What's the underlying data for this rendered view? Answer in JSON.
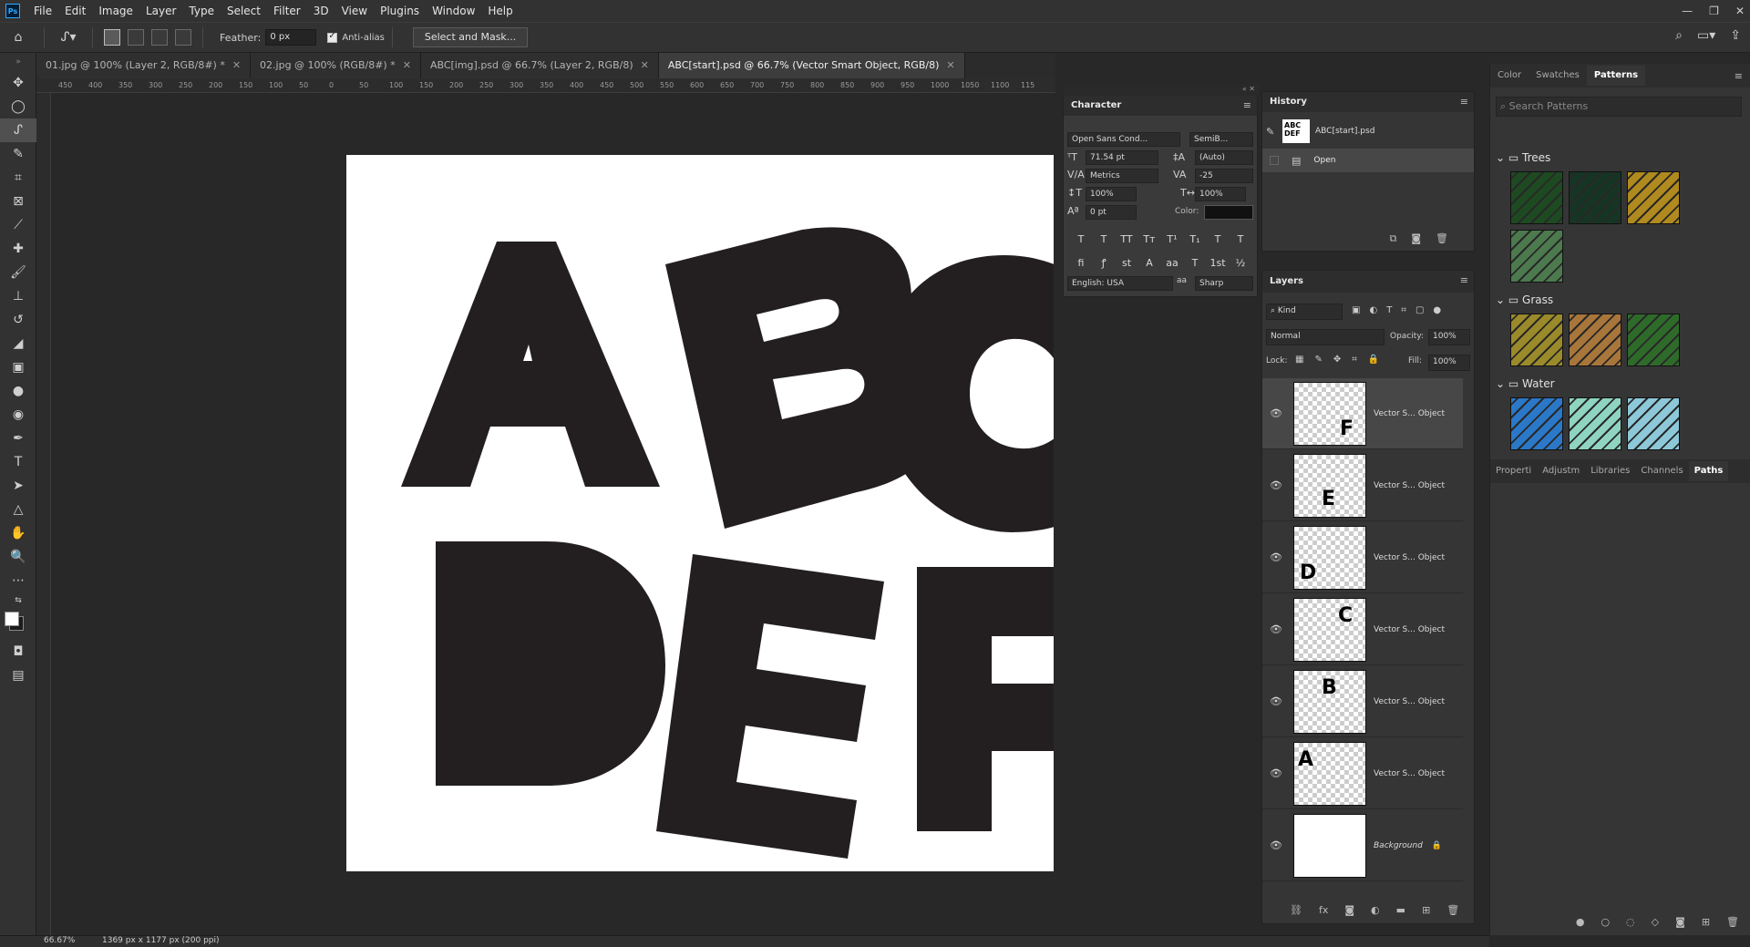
{
  "app": {
    "logo": "Ps"
  },
  "menu": [
    "File",
    "Edit",
    "Image",
    "Layer",
    "Type",
    "Select",
    "Filter",
    "3D",
    "View",
    "Plugins",
    "Window",
    "Help"
  ],
  "window_controls": [
    "—",
    "❐",
    "✕"
  ],
  "options": {
    "feather_label": "Feather:",
    "feather_value": "0 px",
    "antialias_label": "Anti-alias",
    "select_mask_label": "Select and Mask..."
  },
  "tabs": [
    {
      "label": "01.jpg @ 100% (Layer 2, RGB/8#) *",
      "active": false
    },
    {
      "label": "02.jpg @ 100% (RGB/8#) *",
      "active": false
    },
    {
      "label": "ABC[img].psd @ 66.7% (Layer 2, RGB/8)",
      "active": false
    },
    {
      "label": "ABC[start].psd @ 66.7% (Vector Smart Object, RGB/8)",
      "active": true
    }
  ],
  "ruler_labels": [
    "450",
    "400",
    "350",
    "300",
    "250",
    "200",
    "150",
    "100",
    "50",
    "0",
    "50",
    "100",
    "150",
    "200",
    "250",
    "300",
    "350",
    "400",
    "450",
    "500",
    "550",
    "600",
    "650",
    "700",
    "750",
    "800",
    "850",
    "900",
    "950",
    "1000",
    "1050",
    "1100",
    "115"
  ],
  "canvas": {
    "letters": [
      "A",
      "B",
      "C",
      "D",
      "E",
      "F"
    ]
  },
  "character": {
    "title": "Character",
    "font_family": "Open Sans Cond...",
    "font_style": "SemiB...",
    "size": "71.54 pt",
    "leading": "(Auto)",
    "kerning": "Metrics",
    "tracking": "-25",
    "vscale": "100%",
    "hscale": "100%",
    "baseline": "0 pt",
    "color_label": "Color:",
    "language": "English: USA",
    "aa_label": "aa",
    "antialias": "Sharp",
    "style_buttons": [
      "T",
      "T",
      "TT",
      "Tт",
      "T¹",
      "T₁",
      "T",
      "T"
    ],
    "ot_buttons": [
      "fi",
      "ꝭ",
      "st",
      "A",
      "aa",
      "T",
      "1st",
      "½"
    ]
  },
  "history": {
    "title": "History",
    "snapshot": "ABC[start].psd",
    "snapshot_thumb": "ABC DEF",
    "steps": [
      "Open"
    ]
  },
  "layers": {
    "title": "Layers",
    "filter_label": "Kind",
    "blend": "Normal",
    "opacity_label": "Opacity:",
    "opacity": "100%",
    "lock_label": "Lock:",
    "fill_label": "Fill:",
    "fill": "100%",
    "items": [
      {
        "name": "Vector S... Object",
        "thumb": "F",
        "active": true
      },
      {
        "name": "Vector S... Object",
        "thumb": "E",
        "active": false
      },
      {
        "name": "Vector S... Object",
        "thumb": "D",
        "active": false
      },
      {
        "name": "Vector S... Object",
        "thumb": "C",
        "active": false
      },
      {
        "name": "Vector S... Object",
        "thumb": "B",
        "active": false
      },
      {
        "name": "Vector S... Object",
        "thumb": "A",
        "active": false
      },
      {
        "name": "Background",
        "thumb": "",
        "active": false
      }
    ]
  },
  "patterns": {
    "tabs": [
      "Color",
      "Swatches",
      "Patterns"
    ],
    "search_placeholder": "Search Patterns",
    "groups": [
      {
        "name": "Trees",
        "colors": [
          "#1e4a22",
          "#163524",
          "#b08a1e",
          "#4c7a4e"
        ]
      },
      {
        "name": "Grass",
        "colors": [
          "#9a8a2a",
          "#a8763a",
          "#2e6b2a"
        ]
      },
      {
        "name": "Water",
        "colors": [
          "#2b78c8",
          "#8fd4c0",
          "#8cc8d8"
        ]
      }
    ]
  },
  "lower_tabs": [
    "Properti",
    "Adjustm",
    "Libraries",
    "Channels",
    "Paths"
  ],
  "status": {
    "zoom": "66.67%",
    "doc_info": "1369 px x 1177 px (200 ppi)"
  },
  "colors": {
    "letter_fill": "#231f20",
    "panel_bg": "#353535",
    "accent": "#31a8ff"
  }
}
